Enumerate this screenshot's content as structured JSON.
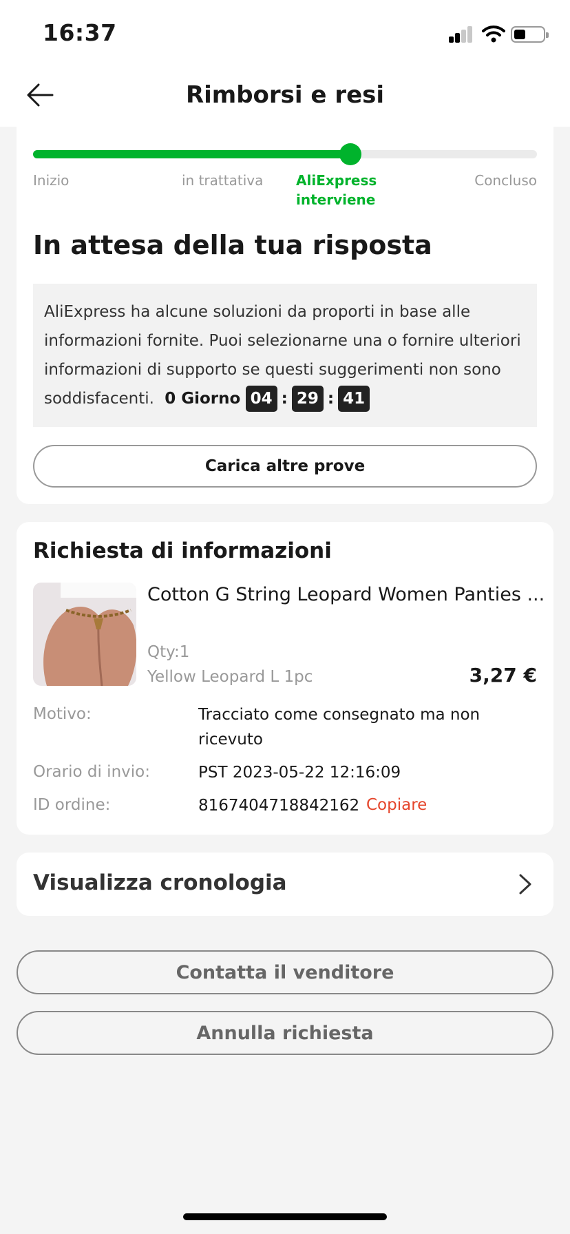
{
  "status_bar": {
    "time": "16:37"
  },
  "header": {
    "title": "Rimborsi e resi"
  },
  "progress": {
    "steps": [
      {
        "label": "Inizio",
        "active": false
      },
      {
        "label": "in trattativa",
        "active": false
      },
      {
        "label": "AliExpress interviene",
        "active": true
      },
      {
        "label": "Concluso",
        "active": false
      }
    ],
    "fill_fraction": 0.63
  },
  "status": {
    "heading": "In attesa della tua risposta",
    "message": "AliExpress ha alcune soluzioni da proporti in base alle informazioni fornite. Puoi selezionarne una o fornire ulteriori informazioni di supporto se questi suggerimenti non sono soddisfacenti.",
    "countdown": {
      "label": "0 Giorno",
      "hours": "04",
      "minutes": "29",
      "seconds": "41",
      "separator": ":"
    },
    "upload_button": "Carica altre prove"
  },
  "info": {
    "section_title": "Richiesta di informazioni",
    "product": {
      "title": "Cotton G String Leopard Women Panties ...",
      "qty": "Qty:1",
      "variant": "Yellow Leopard L 1pc",
      "price": "3,27 €"
    },
    "rows": {
      "reason_label": "Motivo:",
      "reason_value_line1": "Tracciato come consegnato ma non",
      "reason_value_line2": "ricevuto",
      "sent_label": "Orario di invio:",
      "sent_value": "PST 2023-05-22 12:16:09",
      "order_label": "ID ordine:",
      "order_value": "8167404718842162",
      "copy_label": "Copiare"
    }
  },
  "history": {
    "label": "Visualizza cronologia"
  },
  "actions": {
    "contact_seller": "Contatta il venditore",
    "cancel_request": "Annulla richiesta"
  },
  "colors": {
    "accent_green": "#00b32c",
    "link_red": "#e5462c",
    "background": "#f4f4f4"
  }
}
